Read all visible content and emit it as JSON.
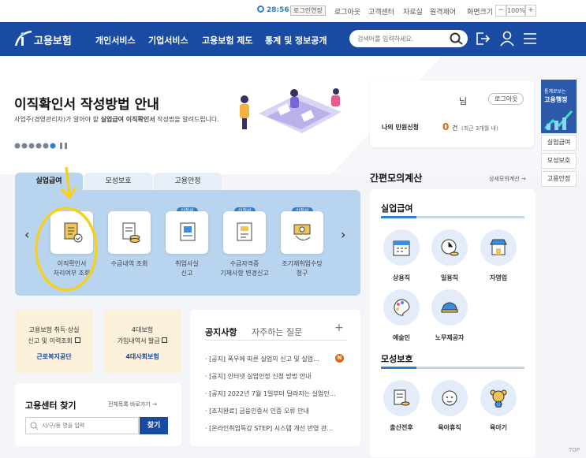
{
  "util": {
    "time": "28:56",
    "extend_label": "로그인연장",
    "logout": "로그아웃",
    "customer_center": "고객센터",
    "data_room": "자료실",
    "remote_control": "원격제어",
    "screen_size": "화면크기",
    "zoom_minus": "−",
    "zoom_value": "100%",
    "zoom_plus": "+"
  },
  "gnb": {
    "logo": "고용보험",
    "menus": [
      "개인서비스",
      "기업서비스",
      "고용보험 제도",
      "통계 및 정보공개"
    ],
    "search_placeholder": "검색어를 입력하세요."
  },
  "hero": {
    "title": "이직확인서 작성방법 안내",
    "desc_part1": "사업주(경영관리자)가 알아야 할 ",
    "desc_bold": "실업급여 이직확인서",
    "desc_part2": " 작성법을 알려드립니다."
  },
  "login": {
    "suffix": "님",
    "logout_button": "로그아웃",
    "complaint_label": "나의 민원신청",
    "count": "0",
    "count_unit": "건",
    "count_note": "(최근 3개월 내)"
  },
  "side_banner": {
    "line1": "통계로보는",
    "line2": "고용행정",
    "tabs": [
      "실업급여",
      "모성보호",
      "고용안정"
    ]
  },
  "service_tabs": [
    "실업급여",
    "모성보호",
    "고용안정"
  ],
  "services": [
    {
      "label1": "이직확인서",
      "label2": "처리여부 조회",
      "badge": ""
    },
    {
      "label1": "수급내역 조회",
      "label2": "",
      "badge": ""
    },
    {
      "label1": "취업사실",
      "label2": "신고",
      "badge": "신청서"
    },
    {
      "label1": "수급자격증",
      "label2": "기재사항 변경신고",
      "badge": "신청서"
    },
    {
      "label1": "조기재취업수당",
      "label2": "청구",
      "badge": "신청서"
    }
  ],
  "promo": {
    "left_line1": "고용보험 취득·상실",
    "left_line2": "신고 및 이력조회",
    "left_org": "근로복지공단",
    "right_line1": "4대보험",
    "right_line2": "가입내역서 발급",
    "right_org": "4대사회보험"
  },
  "center": {
    "title": "고용센터 찾기",
    "all_link": "전체목록 바로가기",
    "placeholder": "시/구/동 명을 입력",
    "button": "찾기"
  },
  "notice": {
    "tab1": "공지사항",
    "tab2": "자주하는 질문",
    "plus": "+",
    "new_badge": "N",
    "items": [
      "[공지] 폭우에 따른 실업의 신고 및 실업…",
      "[공지] 인터넷 실업인정 신청 방법 안내",
      "[공지] 2022년 7월 1일부터 달라지는 실업인…",
      "[조치완료] 금융인증서 인증 오류 안내",
      "[온라인취업특강 STEP] 시스템 개선 반영 관…"
    ]
  },
  "calc": {
    "title": "간편모의계산",
    "detail_link": "상세모의계산",
    "section1": "실업급여",
    "items1": [
      "상용직",
      "일용직",
      "자영업",
      "예술인",
      "노무제공자"
    ],
    "section2": "모성보호",
    "items2": [
      "출산전후",
      "육아휴직",
      "육아기"
    ]
  },
  "top_button": "TOP",
  "colors": {
    "brand": "#1a4ba3",
    "accent": "#2d7fd1",
    "highlight": "#f5d020"
  }
}
